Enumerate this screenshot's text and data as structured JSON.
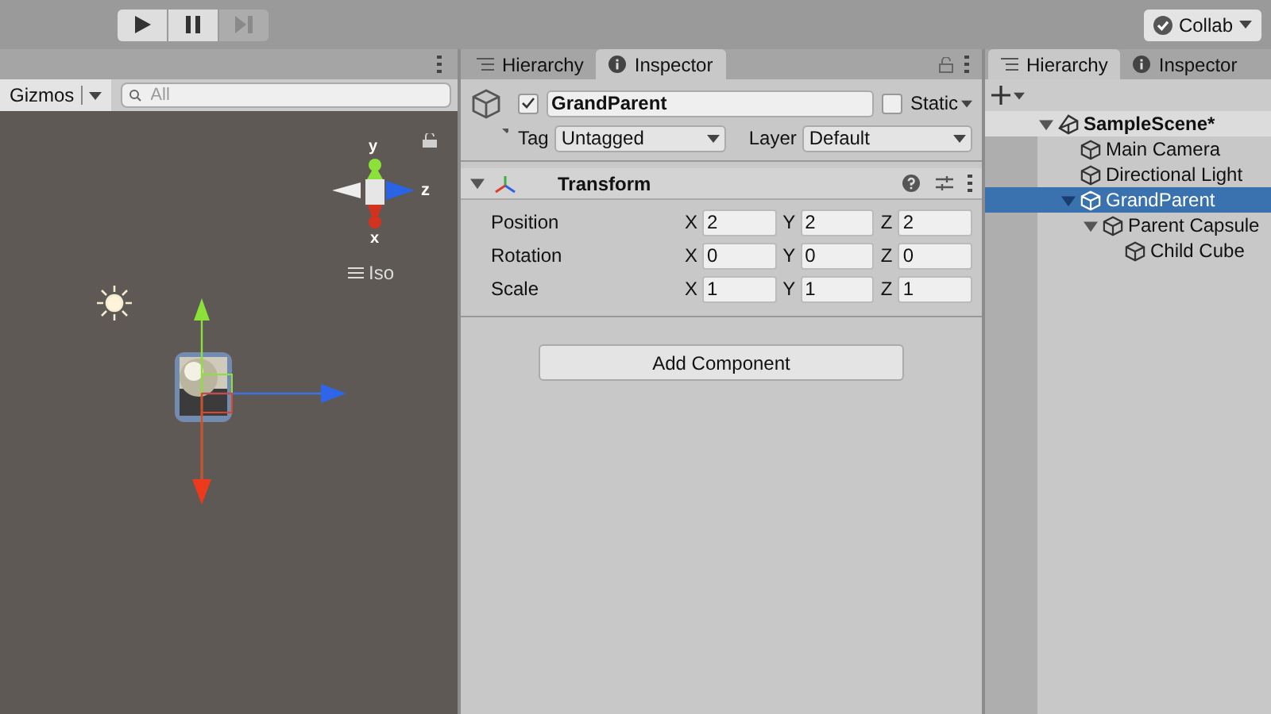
{
  "toolbar": {
    "play_buttons": [
      {
        "kind": "play",
        "disabled": false
      },
      {
        "kind": "pause",
        "disabled": false
      },
      {
        "kind": "step",
        "disabled": true
      }
    ],
    "collab": {
      "label": "Collab"
    }
  },
  "scene": {
    "gizmos": "Gizmos",
    "search": {
      "placeholder": "All"
    },
    "axes": {
      "y": "y",
      "z": "z",
      "x": "x"
    },
    "projection": "Iso"
  },
  "inspector": {
    "tabs": [
      {
        "kind": "hierarchy",
        "label": "Hierarchy",
        "selected": false
      },
      {
        "kind": "inspector",
        "label": "Inspector",
        "selected": true
      }
    ],
    "object": {
      "active": true,
      "name": "GrandParent",
      "static_label": "Static",
      "static": false,
      "tag_label": "Tag",
      "tag": "Untagged",
      "layer_label": "Layer",
      "layer": "Default"
    },
    "component": {
      "title": "Transform",
      "expanded": true,
      "rows": [
        {
          "label": "Position",
          "values": [
            {
              "axis": "X",
              "value": "2"
            },
            {
              "axis": "Y",
              "value": "2"
            },
            {
              "axis": "Z",
              "value": "2"
            }
          ]
        },
        {
          "label": "Rotation",
          "values": [
            {
              "axis": "X",
              "value": "0"
            },
            {
              "axis": "Y",
              "value": "0"
            },
            {
              "axis": "Z",
              "value": "0"
            }
          ]
        },
        {
          "label": "Scale",
          "values": [
            {
              "axis": "X",
              "value": "1"
            },
            {
              "axis": "Y",
              "value": "1"
            },
            {
              "axis": "Z",
              "value": "1"
            }
          ]
        }
      ]
    },
    "add_component": "Add Component"
  },
  "hierarchy": {
    "tabs": [
      {
        "kind": "hierarchy",
        "label": "Hierarchy",
        "selected": true
      },
      {
        "kind": "inspector",
        "label": "Inspector",
        "selected": false
      }
    ],
    "tree": [
      {
        "kind": "scene",
        "label": "SampleScene*",
        "expanded": true,
        "selected": false,
        "children": [
          {
            "kind": "object",
            "label": "Main Camera",
            "selected": false
          },
          {
            "kind": "object",
            "label": "Directional Light",
            "selected": false
          },
          {
            "kind": "object",
            "label": "GrandParent",
            "expanded": true,
            "selected": true,
            "children": [
              {
                "kind": "object",
                "label": "Parent Capsule",
                "expanded": true,
                "selected": false,
                "children": [
                  {
                    "kind": "object",
                    "label": "Child Cube",
                    "selected": false
                  }
                ]
              }
            ]
          }
        ]
      }
    ]
  }
}
